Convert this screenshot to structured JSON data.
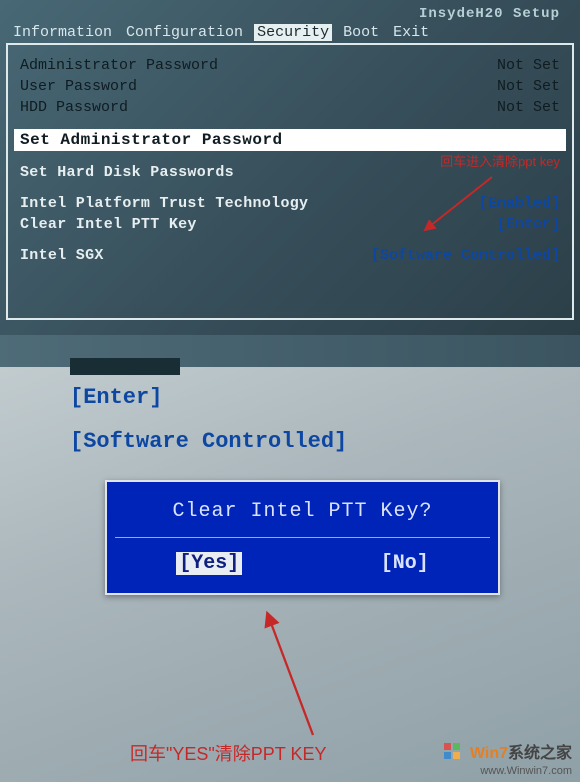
{
  "bios_title": "InsydeH20 Setup",
  "menu": {
    "items": [
      "Information",
      "Configuration",
      "Security",
      "Boot",
      "Exit"
    ],
    "active_index": 2
  },
  "security": {
    "admin_pw_label": "Administrator Password",
    "admin_pw_value": "Not Set",
    "user_pw_label": "User Password",
    "user_pw_value": "Not Set",
    "hdd_pw_label": "HDD Password",
    "hdd_pw_value": "Not Set",
    "set_admin": "Set Administrator Password",
    "set_hdd": "Set Hard Disk Passwords",
    "ptt_label": "Intel Platform Trust Technology",
    "ptt_value": "[Enabled]",
    "clear_ptt_label": "Clear Intel PTT Key",
    "clear_ptt_value": "[Enter]",
    "sgx_label": "Intel SGX",
    "sgx_value": "[Software Controlled]"
  },
  "annotation_top": "回车进入清除ppt key",
  "bottom": {
    "enter": "[Enter]",
    "soft": "[Software Controlled]"
  },
  "dialog": {
    "title": "Clear Intel PTT Key?",
    "yes": "[Yes]",
    "no": "[No]"
  },
  "annotation_bottom": "回车\"YES\"清除PPT KEY",
  "watermark": {
    "brand_prefix": "Win7",
    "brand_suffix": "系统之家",
    "url": "www.Winwin7.com"
  }
}
